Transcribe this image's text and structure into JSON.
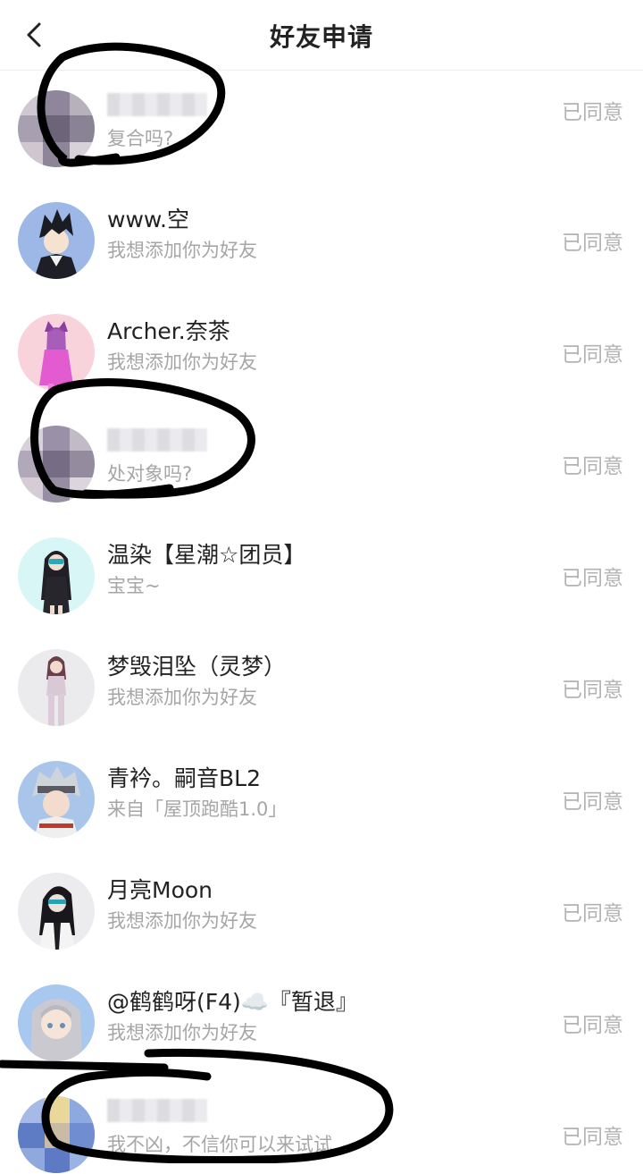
{
  "header": {
    "title": "好友申请"
  },
  "requests": [
    {
      "name": "",
      "message": "复合吗?",
      "status": "已同意"
    },
    {
      "name": "www.空",
      "message": "我想添加你为好友",
      "status": "已同意"
    },
    {
      "name": "Archer.奈茶",
      "message": "我想添加你为好友",
      "status": "已同意"
    },
    {
      "name": "",
      "message": "处对象吗?",
      "status": "已同意"
    },
    {
      "name": "温染【星潮☆团员】",
      "message": "宝宝~",
      "status": "已同意"
    },
    {
      "name": "梦毁泪坠（灵梦）",
      "message": "我想添加你为好友",
      "status": "已同意"
    },
    {
      "name": "青衿。嗣音BL2",
      "message": "来自「屋顶跑酷1.0」",
      "status": "已同意"
    },
    {
      "name": "月亮Moon",
      "message": "我想添加你为好友",
      "status": "已同意"
    },
    {
      "name": "@鹤鹤呀(F4)☁️『暂退』",
      "message": "我想添加你为好友",
      "status": "已同意"
    },
    {
      "name": "",
      "message": "我不凶，不信你可以来试试",
      "status": "已同意"
    }
  ]
}
